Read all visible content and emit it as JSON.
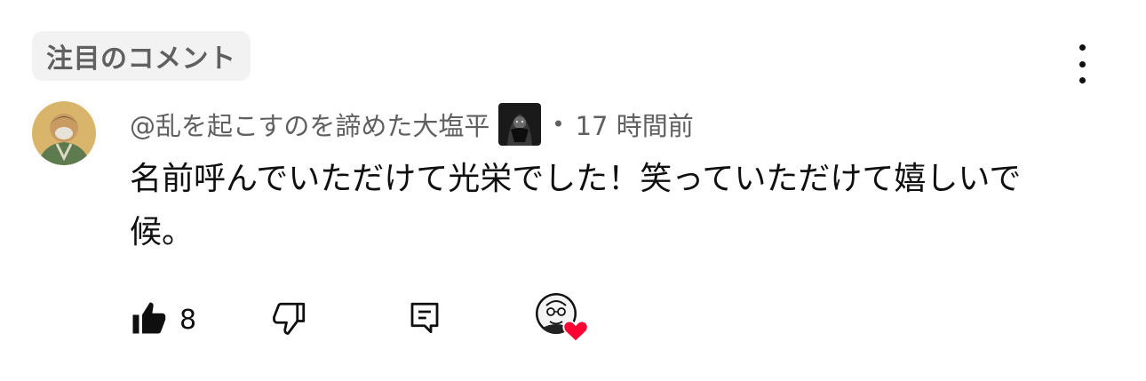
{
  "section": {
    "badge_label": "注目のコメント"
  },
  "comment": {
    "author": "@乱を起こすのを諦めた大塩平",
    "separator": "•",
    "time": "17 時間前",
    "text": "名前呼んでいただけて光栄でした！笑っていただけて嬉しいで候。"
  },
  "actions": {
    "like_count": "8"
  },
  "icons": {
    "more": "more-vert-icon",
    "like": "thumbs-up-icon",
    "dislike": "thumbs-down-icon",
    "reply": "reply-icon",
    "heart": "heart-icon"
  },
  "colors": {
    "heart": "#ff0033",
    "secondary_text": "#606060",
    "badge_bg": "#f2f2f2"
  }
}
